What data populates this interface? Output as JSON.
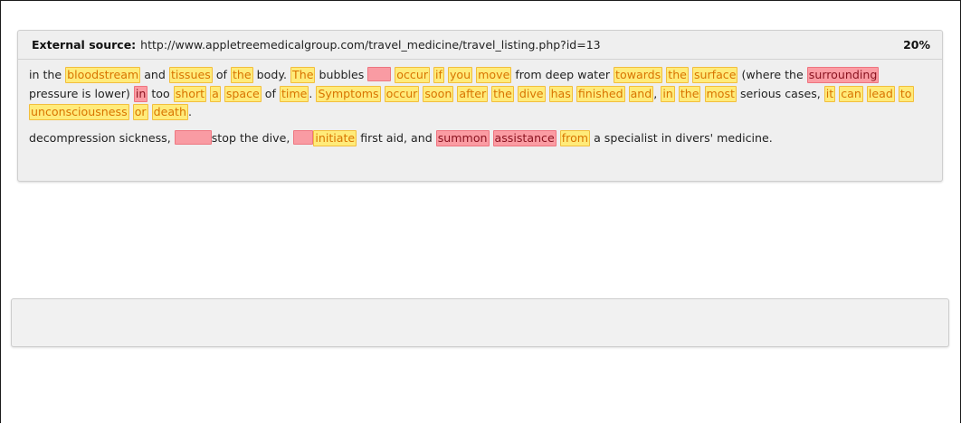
{
  "source": {
    "label": "External source:",
    "url": "http://www.appletreemedicalgroup.com/travel_medicine/travel_listing.php?id=13",
    "percent": "20%"
  },
  "paragraphs": [
    {
      "tokens": [
        {
          "text": "in the",
          "hl": ""
        },
        {
          "text": "bloodstream",
          "hl": "y"
        },
        {
          "text": "and",
          "hl": ""
        },
        {
          "text": "tissues",
          "hl": "y"
        },
        {
          "text": "of",
          "hl": ""
        },
        {
          "text": "the",
          "hl": "y"
        },
        {
          "text": "body.",
          "hl": ""
        },
        {
          "text": "The",
          "hl": "y"
        },
        {
          "text": "bubbles",
          "hl": ""
        },
        {
          "text": "",
          "hl": "blank",
          "width": 26
        },
        {
          "text": "occur",
          "hl": "y"
        },
        {
          "text": "if",
          "hl": "y"
        },
        {
          "text": "you",
          "hl": "y"
        },
        {
          "text": "move",
          "hl": "y"
        },
        {
          "text": "from deep water",
          "hl": ""
        },
        {
          "text": "towards",
          "hl": "y"
        },
        {
          "text": "the",
          "hl": "y"
        },
        {
          "text": "surface",
          "hl": "y"
        },
        {
          "text": "(where the",
          "hl": ""
        },
        {
          "text": "surrounding",
          "hl": "r"
        },
        {
          "text": "pressure is lower)",
          "hl": ""
        },
        {
          "text": "in",
          "hl": "r"
        },
        {
          "text": "too",
          "hl": ""
        },
        {
          "text": "short",
          "hl": "y"
        },
        {
          "text": "a",
          "hl": "y"
        },
        {
          "text": "space",
          "hl": "y"
        },
        {
          "text": "of",
          "hl": ""
        },
        {
          "text": "time",
          "hl": "y"
        },
        {
          "text": ".",
          "hl": "",
          "tight": true
        },
        {
          "text": "Symptoms",
          "hl": "y"
        },
        {
          "text": "occur",
          "hl": "y"
        },
        {
          "text": "soon",
          "hl": "y"
        },
        {
          "text": "after",
          "hl": "y"
        },
        {
          "text": "the",
          "hl": "y"
        },
        {
          "text": "dive",
          "hl": "y"
        },
        {
          "text": "has",
          "hl": "y"
        },
        {
          "text": "finished",
          "hl": "y"
        },
        {
          "text": "and",
          "hl": "y"
        },
        {
          "text": ",",
          "hl": "",
          "tight": true
        },
        {
          "text": "in",
          "hl": "y"
        },
        {
          "text": "the",
          "hl": "y"
        },
        {
          "text": "most",
          "hl": "y"
        },
        {
          "text": "serious cases,",
          "hl": ""
        },
        {
          "text": "it",
          "hl": "y"
        },
        {
          "text": "can",
          "hl": "y"
        },
        {
          "text": "lead",
          "hl": "y"
        },
        {
          "text": "to",
          "hl": "y"
        },
        {
          "text": "unconsciousness",
          "hl": "y"
        },
        {
          "text": "or",
          "hl": "y"
        },
        {
          "text": "death",
          "hl": "y"
        },
        {
          "text": ".",
          "hl": "",
          "tight": true
        }
      ]
    },
    {
      "tokens": [
        {
          "text": "decompression sickness,",
          "hl": ""
        },
        {
          "text": "",
          "hl": "blank",
          "width": 41
        },
        {
          "text": "stop the dive,",
          "hl": "",
          "tight": true
        },
        {
          "text": "",
          "hl": "blank",
          "width": 22
        },
        {
          "text": "initiate",
          "hl": "y",
          "tight": true
        },
        {
          "text": "first aid, and",
          "hl": ""
        },
        {
          "text": "summon",
          "hl": "r"
        },
        {
          "text": "assistance",
          "hl": "r"
        },
        {
          "text": "from",
          "hl": "y"
        },
        {
          "text": "a specialist in divers' medicine.",
          "hl": ""
        }
      ]
    }
  ],
  "colors": {
    "highlight_yellow": "#ffeb7a",
    "highlight_yellow_text": "#d97400",
    "highlight_red": "#fb9ca3",
    "highlight_red_text": "#8a1320"
  }
}
